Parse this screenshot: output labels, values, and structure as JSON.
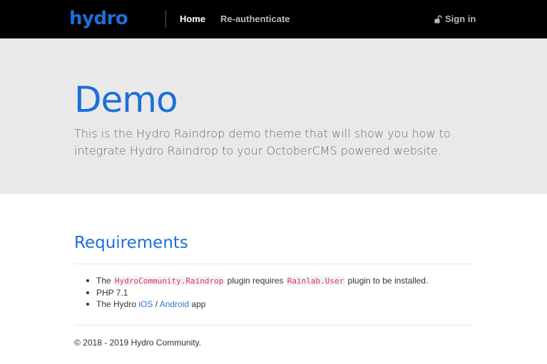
{
  "navbar": {
    "brand": "hydro",
    "links": [
      {
        "label": "Home"
      },
      {
        "label": "Re-authenticate"
      }
    ],
    "signin_label": "Sign in",
    "signin_icon": "unlock-icon"
  },
  "hero": {
    "title": "Demo",
    "lead": "This is the Hydro Raindrop demo theme that will show you how to integrate Hydro Raindrop to your OctoberCMS powered website."
  },
  "requirements": {
    "title": "Requirements",
    "item1": {
      "prefix": "The ",
      "code1": "HydroCommunity.Raindrop",
      "middle": " plugin requires ",
      "code2": "Rainlab.User",
      "suffix": " plugin to be installed."
    },
    "item2": "PHP 7.1",
    "item3": {
      "prefix": "The Hydro ",
      "link1": "iOS",
      "separator": " / ",
      "link2": "Android",
      "suffix": " app"
    }
  },
  "footer": {
    "text": "© 2018 - 2019 Hydro Community."
  },
  "colors": {
    "navbar_bg": "#000000",
    "brand": "#1d6fd9",
    "jumbotron_bg": "#e9e9e9",
    "code": "#d6336c",
    "link": "#2a7ad3"
  }
}
